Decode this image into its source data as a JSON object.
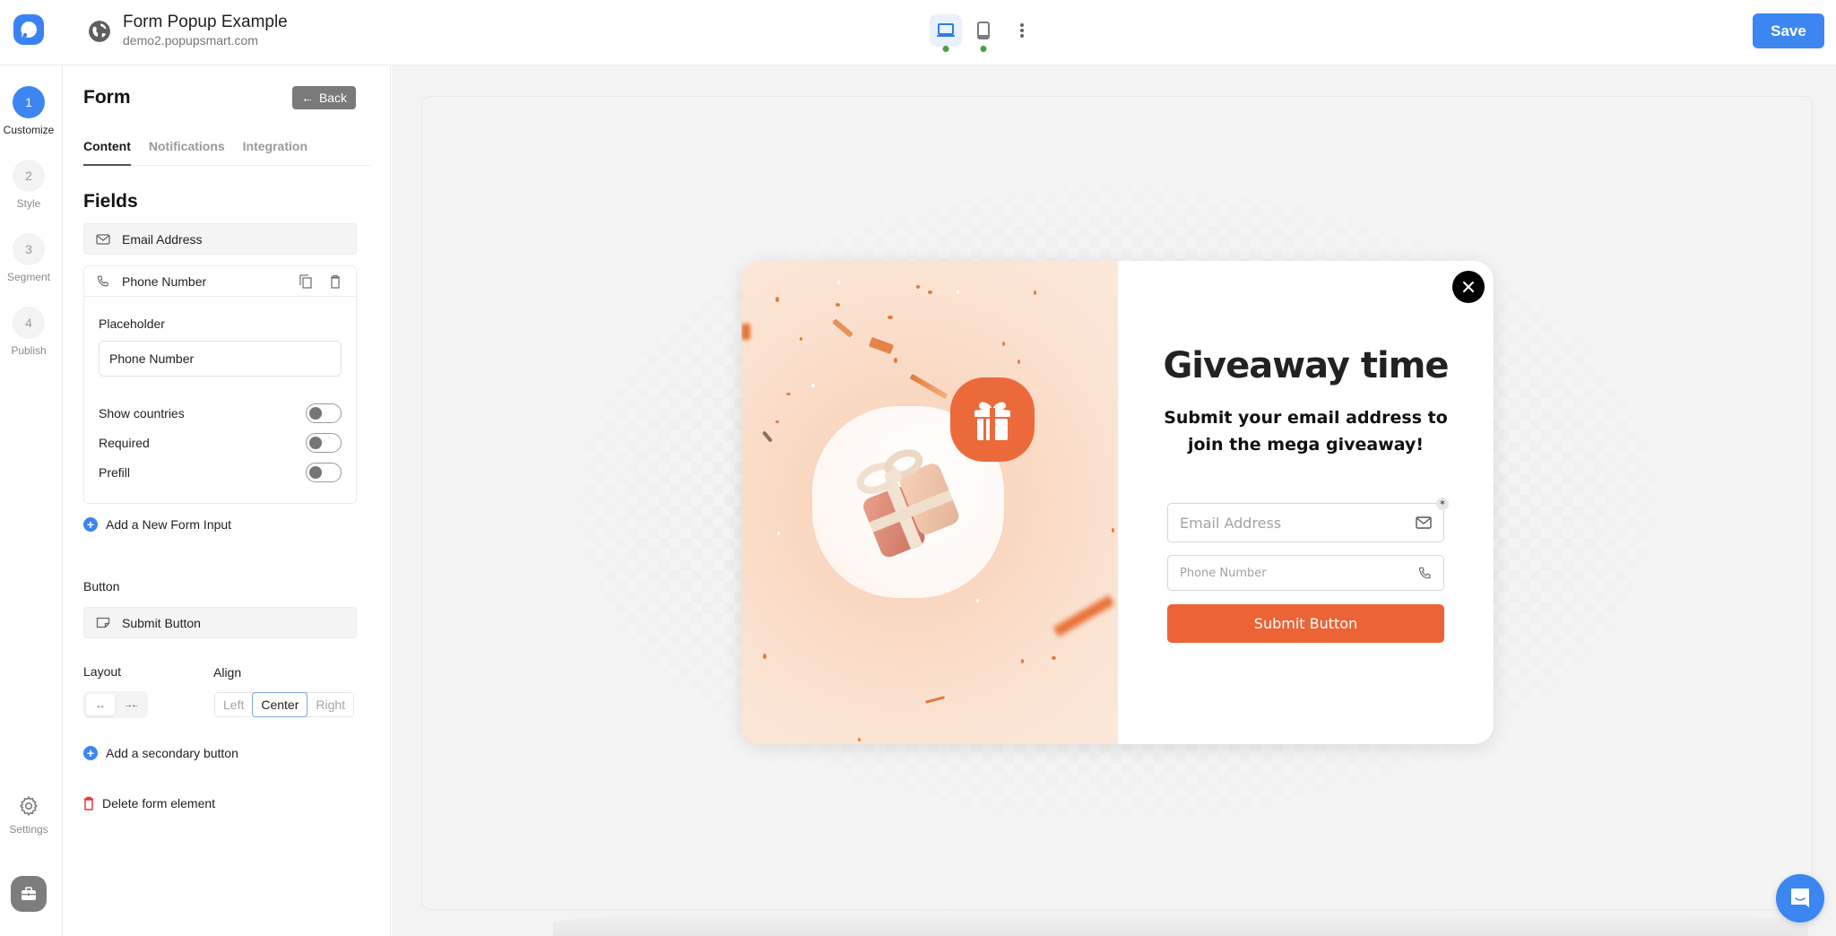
{
  "header": {
    "site_title": "Form Popup Example",
    "site_url": "demo2.popupsmart.com",
    "devices": [
      {
        "name": "desktop",
        "icon": "laptop-icon",
        "active": true,
        "status": "published"
      },
      {
        "name": "mobile",
        "icon": "phone-device-icon",
        "active": false,
        "status": "published"
      }
    ],
    "more_icon": "more-vertical-icon",
    "save_label": "Save",
    "status_color": "#44a047",
    "accent_color": "#3b86f0"
  },
  "steps": [
    {
      "number": "1",
      "label": "Customize",
      "active": true
    },
    {
      "number": "2",
      "label": "Style",
      "active": false
    },
    {
      "number": "3",
      "label": "Segment",
      "active": false
    },
    {
      "number": "4",
      "label": "Publish",
      "active": false
    }
  ],
  "rail": {
    "settings_label": "Settings"
  },
  "panel": {
    "title": "Form",
    "back_label": "Back",
    "tabs": [
      {
        "label": "Content",
        "active": true
      },
      {
        "label": "Notifications",
        "active": false
      },
      {
        "label": "Integration",
        "active": false
      }
    ],
    "fields_title": "Fields",
    "fields": [
      {
        "label": "Email Address",
        "icon": "mail-icon"
      },
      {
        "label": "Phone Number",
        "icon": "phone-icon",
        "expanded": true
      }
    ],
    "phone_settings": {
      "placeholder_label": "Placeholder",
      "placeholder_value": "Phone Number",
      "toggles": [
        {
          "label": "Show countries",
          "on": false
        },
        {
          "label": "Required",
          "on": false
        },
        {
          "label": "Prefill",
          "on": false
        }
      ]
    },
    "add_input_label": "Add a New Form Input",
    "button_section_label": "Button",
    "button_item_label": "Submit Button",
    "layout_label": "Layout",
    "layout_options": [
      {
        "glyph": "↔",
        "name": "full-width",
        "active": true
      },
      {
        "glyph": "→←",
        "name": "auto-width",
        "active": false
      }
    ],
    "align_label": "Align",
    "align_options": [
      {
        "label": "Left",
        "active": false
      },
      {
        "label": "Center",
        "active": true
      },
      {
        "label": "Right",
        "active": false
      }
    ],
    "add_secondary_label": "Add a secondary button",
    "delete_label": "Delete form element",
    "delete_color": "#e03b3b"
  },
  "popup": {
    "headline": "Giveaway time",
    "subheadline": "Submit your email address to join the mega giveaway!",
    "email_placeholder": "Email Address",
    "email_required_mark": "*",
    "phone_placeholder": "Phone Number",
    "submit_label": "Submit Button",
    "brand_color": "#ec6436",
    "panel_bg_color": "#f9d8c2"
  }
}
